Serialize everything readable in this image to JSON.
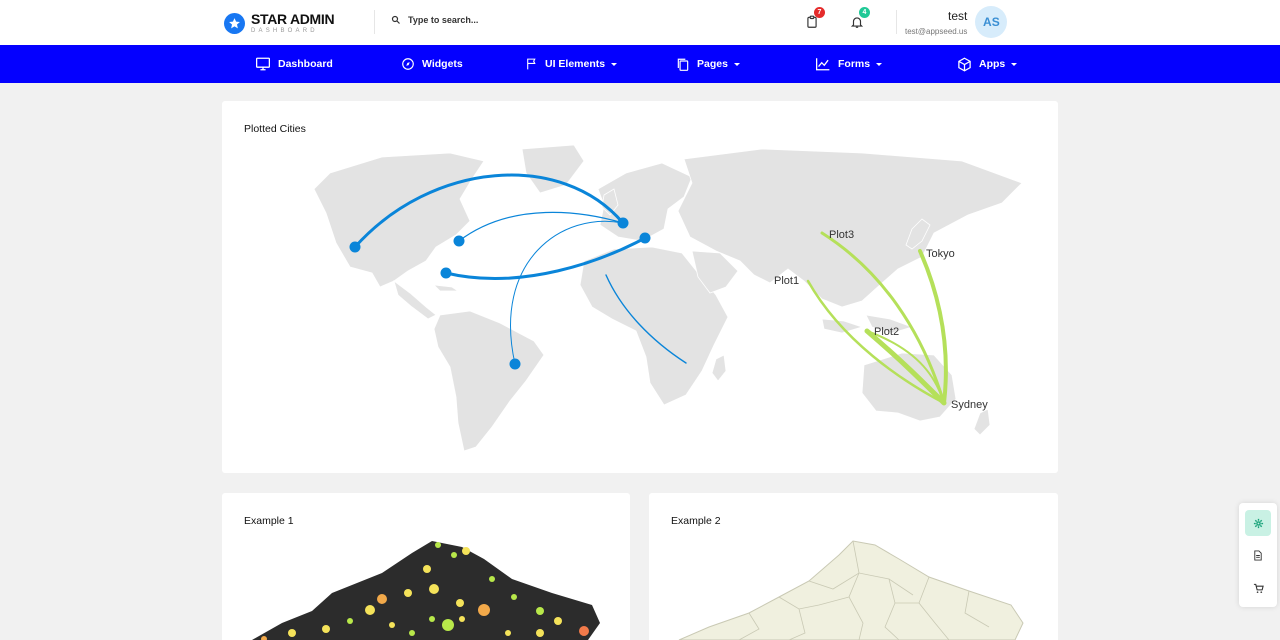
{
  "brand": {
    "title": "STAR ADMIN",
    "subtitle": "DASHBOARD",
    "icon": "star-icon",
    "color": "#1877f2"
  },
  "search": {
    "placeholder": "Type to search...",
    "value": "",
    "icon": "search-icon"
  },
  "notifications": [
    {
      "icon": "clipboard-icon",
      "count": "7",
      "color": "#e52b2b"
    },
    {
      "icon": "bell-icon",
      "count": "4",
      "color": "#20c997"
    }
  ],
  "user": {
    "name": "test",
    "email": "test@appseed.us",
    "initials": "AS"
  },
  "nav": {
    "color": "#0400ff",
    "items": [
      {
        "label": "Dashboard",
        "icon": "monitor-icon",
        "dropdown": false
      },
      {
        "label": "Widgets",
        "icon": "compass-icon",
        "dropdown": false
      },
      {
        "label": "UI Elements",
        "icon": "flag-icon",
        "dropdown": true
      },
      {
        "label": "Pages",
        "icon": "copy-icon",
        "dropdown": true
      },
      {
        "label": "Forms",
        "icon": "chart-line-icon",
        "dropdown": true
      },
      {
        "label": "Apps",
        "icon": "box-icon",
        "dropdown": true
      }
    ]
  },
  "map_card": {
    "title": "Plotted Cities",
    "labels": {
      "plot3": "Plot3",
      "plot1": "Plot1",
      "plot2": "Plot2",
      "tokyo": "Tokyo",
      "sydney": "Sydney"
    },
    "colors": {
      "routes_west": "#0a85d9",
      "routes_east": "#b5e05a",
      "land": "#e3e3e3"
    }
  },
  "example1": {
    "title": "Example 1"
  },
  "example2": {
    "title": "Example 2"
  },
  "side_panel": [
    {
      "icon": "gear-icon",
      "active": true
    },
    {
      "icon": "document-icon",
      "active": false
    },
    {
      "icon": "cart-icon",
      "active": false
    }
  ]
}
